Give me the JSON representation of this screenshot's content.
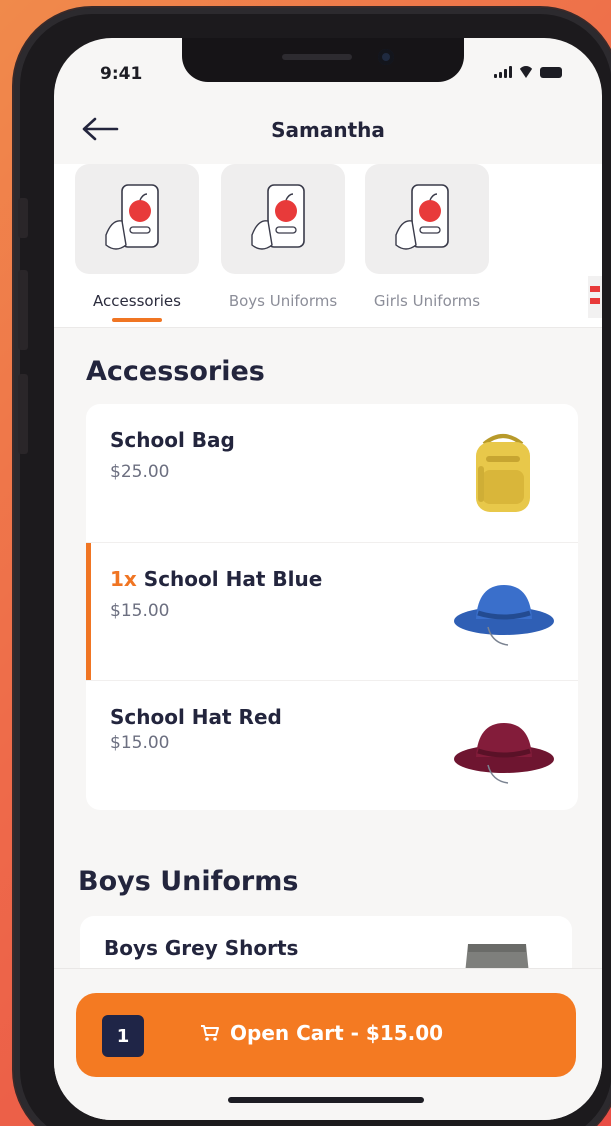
{
  "status_bar": {
    "time": "9:41"
  },
  "header": {
    "title": "Samantha"
  },
  "categories": [
    {
      "label": "Accessories",
      "active": true
    },
    {
      "label": "Boys Uniforms",
      "active": false
    },
    {
      "label": "Girls Uniforms",
      "active": false
    }
  ],
  "sections": [
    {
      "title": "Accessories",
      "items": [
        {
          "name": "School Bag",
          "price": "$25.00",
          "quantity": "",
          "image": "yellow-backpack"
        },
        {
          "name": "School Hat Blue",
          "price": "$15.00",
          "quantity": "1x",
          "image": "blue-hat"
        },
        {
          "name": "School Hat Red",
          "price": "$15.00",
          "quantity": "",
          "image": "maroon-hat"
        }
      ]
    },
    {
      "title": "Boys Uniforms",
      "items": [
        {
          "name": "Boys Grey Shorts",
          "price": "",
          "quantity": "",
          "image": "grey-shorts"
        }
      ]
    }
  ],
  "cart": {
    "count": "1",
    "label": "Open Cart - $15.00"
  },
  "colors": {
    "accent": "#f07523",
    "navy": "#1f2547",
    "text_dark": "#23253d",
    "text_muted": "#8c8e99",
    "background": "#f7f6f5"
  },
  "icons": {
    "back": "arrow-left-icon",
    "cart": "cart-icon",
    "category": "phone-apple-icon"
  }
}
